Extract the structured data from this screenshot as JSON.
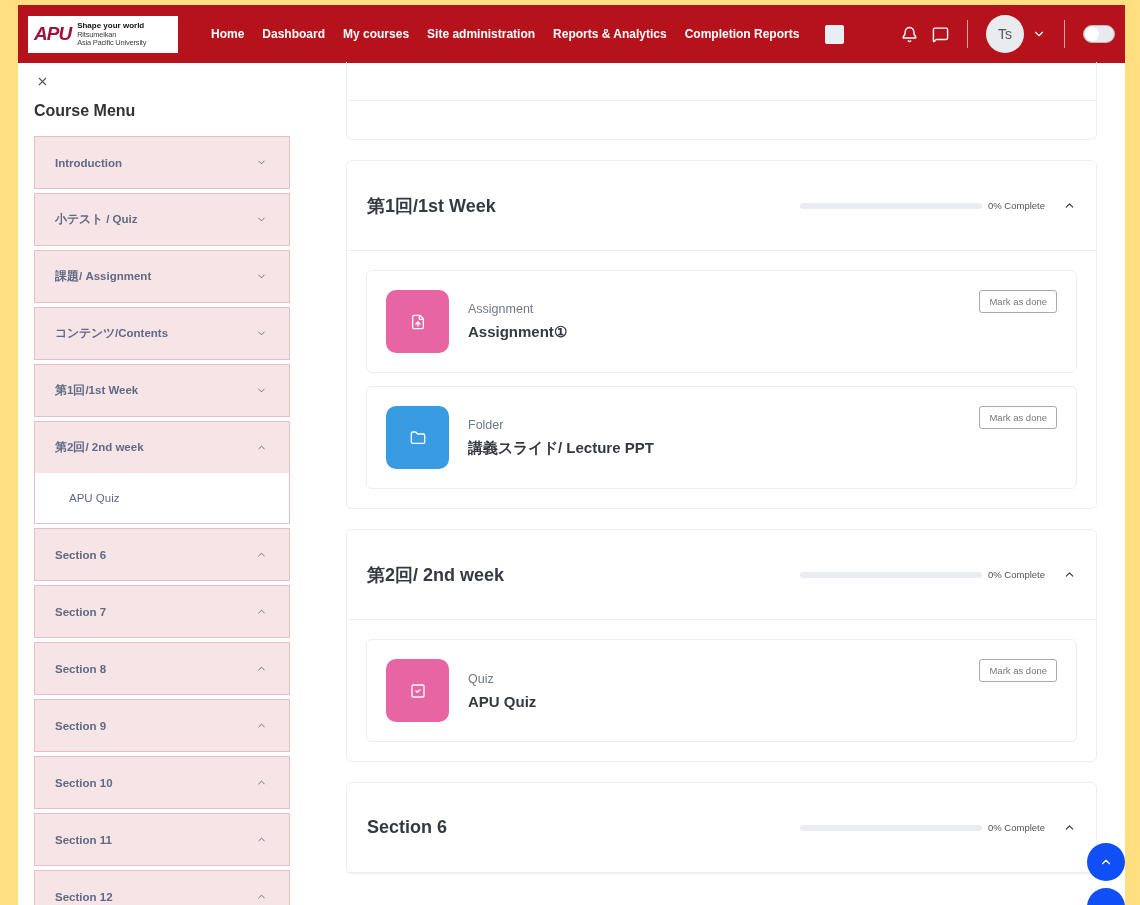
{
  "navbar": {
    "logo": {
      "mark": "APU",
      "tagline": "Shape your world",
      "name_line_1": "Ritsumeikan",
      "name_line_2": "Asia Pacific University"
    },
    "links": [
      "Home",
      "Dashboard",
      "My courses",
      "Site administration",
      "Reports & Analytics",
      "Completion Reports"
    ],
    "avatar": {
      "initials": "Ts"
    },
    "mode_switch": {
      "on": false
    }
  },
  "course_menu": {
    "title": "Course Menu",
    "items": [
      {
        "label": "Introduction",
        "expanded": false
      },
      {
        "label": "小テスト / Quiz",
        "expanded": false
      },
      {
        "label": "課題/ Assignment",
        "expanded": false
      },
      {
        "label": "コンテンツ/Contents",
        "expanded": false
      },
      {
        "label": "第1回/1st Week",
        "expanded": false
      },
      {
        "label": "第2回/ 2nd week",
        "expanded": true,
        "children": [
          {
            "label": "APU Quiz"
          }
        ]
      },
      {
        "label": "Section 6",
        "expanded": true
      },
      {
        "label": "Section 7",
        "expanded": true
      },
      {
        "label": "Section 8",
        "expanded": true
      },
      {
        "label": "Section 9",
        "expanded": true
      },
      {
        "label": "Section 10",
        "expanded": true
      },
      {
        "label": "Section 11",
        "expanded": true
      },
      {
        "label": "Section 12",
        "expanded": true
      }
    ]
  },
  "sections": [
    {
      "title": "第1回/1st Week",
      "level": 0,
      "reading": "0% Complete",
      "expanded": true,
      "activities": [
        {
          "kind": "assignment",
          "type": "Assignment",
          "name": "Assignment①",
          "button": "Mark as done"
        },
        {
          "kind": "folder",
          "type": "Folder",
          "name": "講義スライド/ Lecture PPT",
          "button": "Mark as done"
        }
      ]
    },
    {
      "title": "第2回/ 2nd week",
      "level": 0,
      "reading": "0% Complete",
      "expanded": true,
      "activities": [
        {
          "kind": "quiz",
          "type": "Quiz",
          "name": "APU Quiz",
          "button": "Mark as done"
        }
      ]
    },
    {
      "title": "Section 6",
      "level": 0,
      "reading": "0% Complete",
      "expanded": true
    }
  ]
}
